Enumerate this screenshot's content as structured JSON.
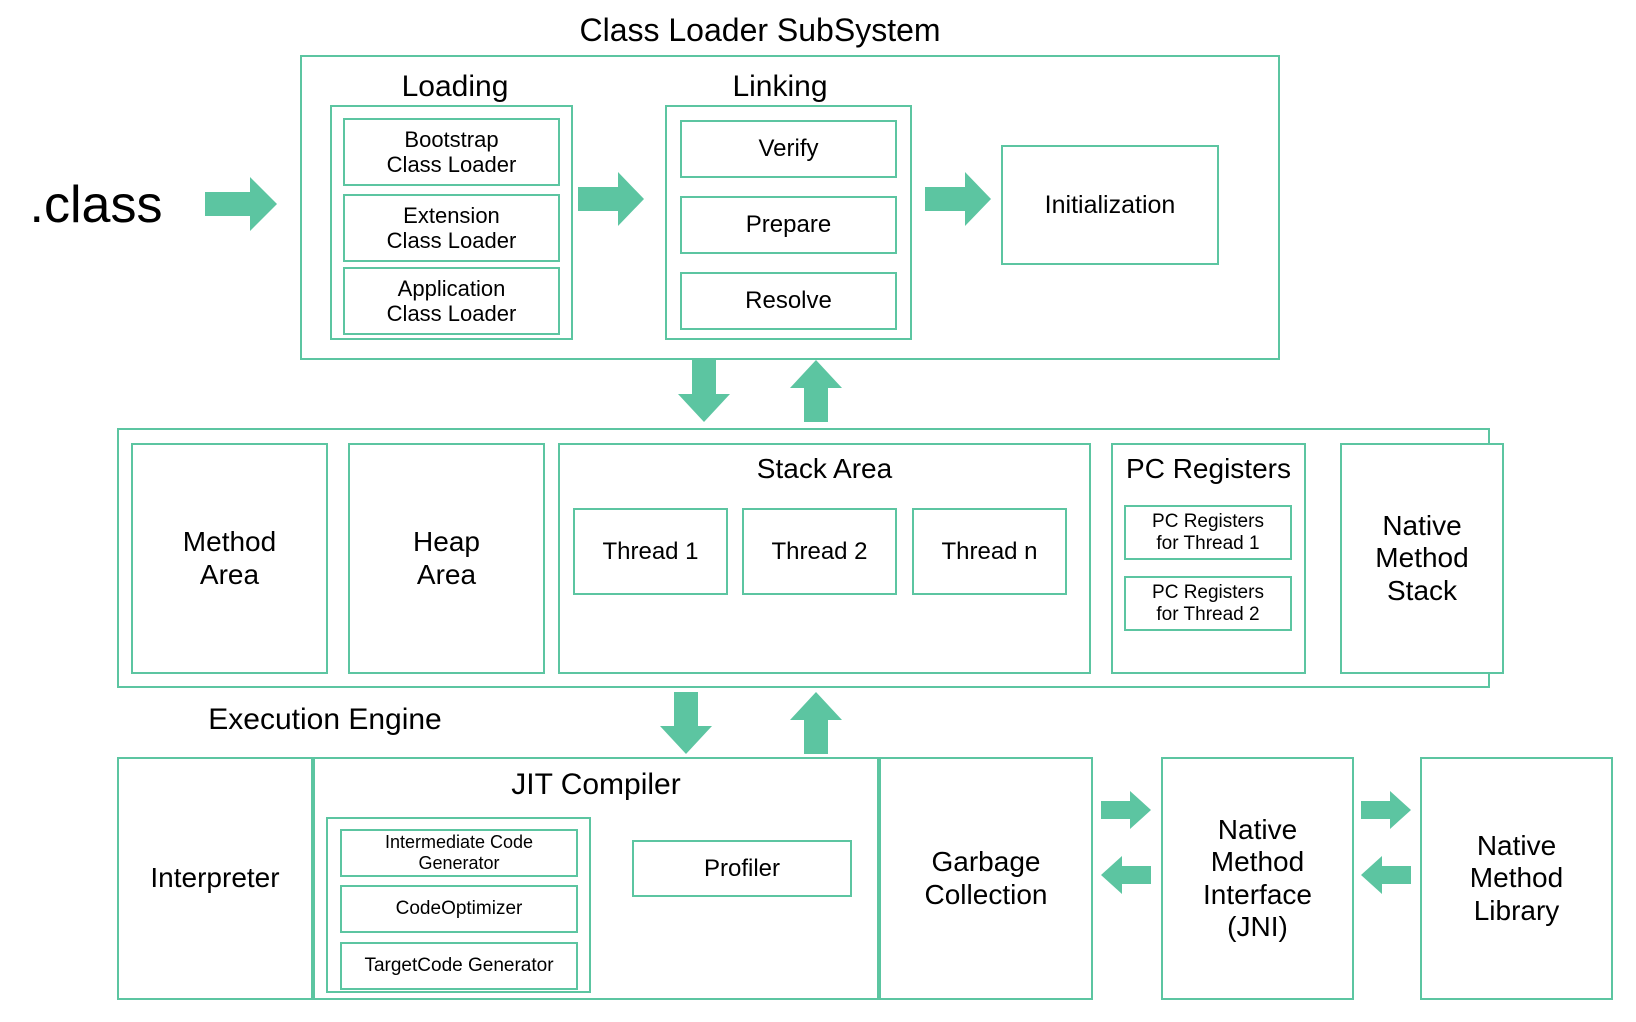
{
  "diagram": {
    "title": "Class Loader SubSystem",
    "accent_color": "#5cc5a1",
    "text_color": "#000000",
    "background": "#ffffff"
  },
  "input": {
    "label": ".class",
    "arrow_icon": "arrow-right-icon"
  },
  "class_loader": {
    "title": "Class Loader SubSystem",
    "loading": {
      "title": "Loading",
      "items": [
        "Bootstrap\nClass Loader",
        "Extension\nClass Loader",
        "Application\nClass Loader"
      ]
    },
    "linking": {
      "title": "Linking",
      "items": [
        "Verify",
        "Prepare",
        "Resolve"
      ]
    },
    "initialization": {
      "label": "Initialization"
    },
    "arrows": [
      "arrow-right-icon",
      "arrow-right-icon"
    ]
  },
  "runtime_data_area": {
    "method_area": "Method\nArea",
    "heap_area": "Heap\nArea",
    "stack_area": {
      "title": "Stack Area",
      "threads": [
        "Thread 1",
        "Thread 2",
        "Thread n"
      ]
    },
    "pc_registers": {
      "title": "PC Registers",
      "items": [
        "PC Registers\nfor Thread 1",
        "PC Registers\nfor Thread 2"
      ]
    },
    "native_method_stack": "Native\nMethod\nStack"
  },
  "connectors": {
    "class_loader_to_runtime_down": "arrow-down-icon",
    "runtime_to_class_loader_up": "arrow-up-icon",
    "runtime_to_engine_down": "arrow-down-icon",
    "engine_to_runtime_up": "arrow-up-icon",
    "gc_to_jni": "arrow-right-icon",
    "jni_to_gc": "arrow-left-icon",
    "jni_to_library": "arrow-right-icon",
    "library_to_jni": "arrow-left-icon"
  },
  "execution_engine": {
    "title": "Execution Engine",
    "interpreter": "Interpreter",
    "jit_compiler": {
      "title": "JIT Compiler",
      "items": [
        "Intermediate Code\nGenerator",
        "CodeOptimizer",
        "TargetCode Generator"
      ],
      "profiler": "Profiler"
    },
    "garbage_collection": "Garbage\nCollection"
  },
  "native": {
    "method_interface": "Native\nMethod\nInterface\n(JNI)",
    "method_library": "Native\nMethod\nLibrary"
  }
}
